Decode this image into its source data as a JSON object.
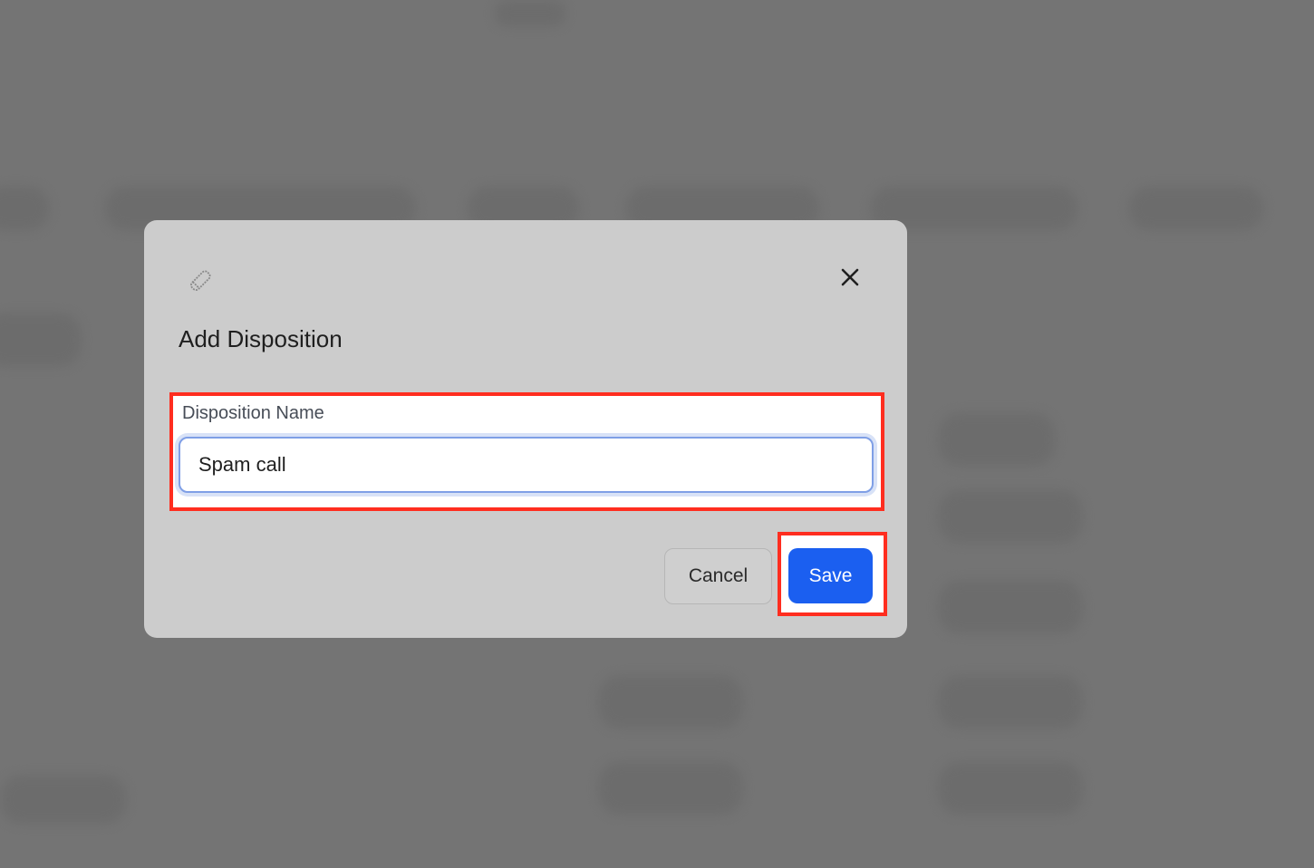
{
  "modal": {
    "title": "Add Disposition",
    "header_icon": "pencil-icon",
    "close_icon": "close-icon"
  },
  "form": {
    "label": "Disposition Name",
    "value": "Spam call"
  },
  "actions": {
    "cancel_label": "Cancel",
    "save_label": "Save"
  },
  "colors": {
    "backdrop": "#747474",
    "modal_background": "#cccccc",
    "primary": "#1b5ff0",
    "highlight": "#ff2d1f"
  }
}
